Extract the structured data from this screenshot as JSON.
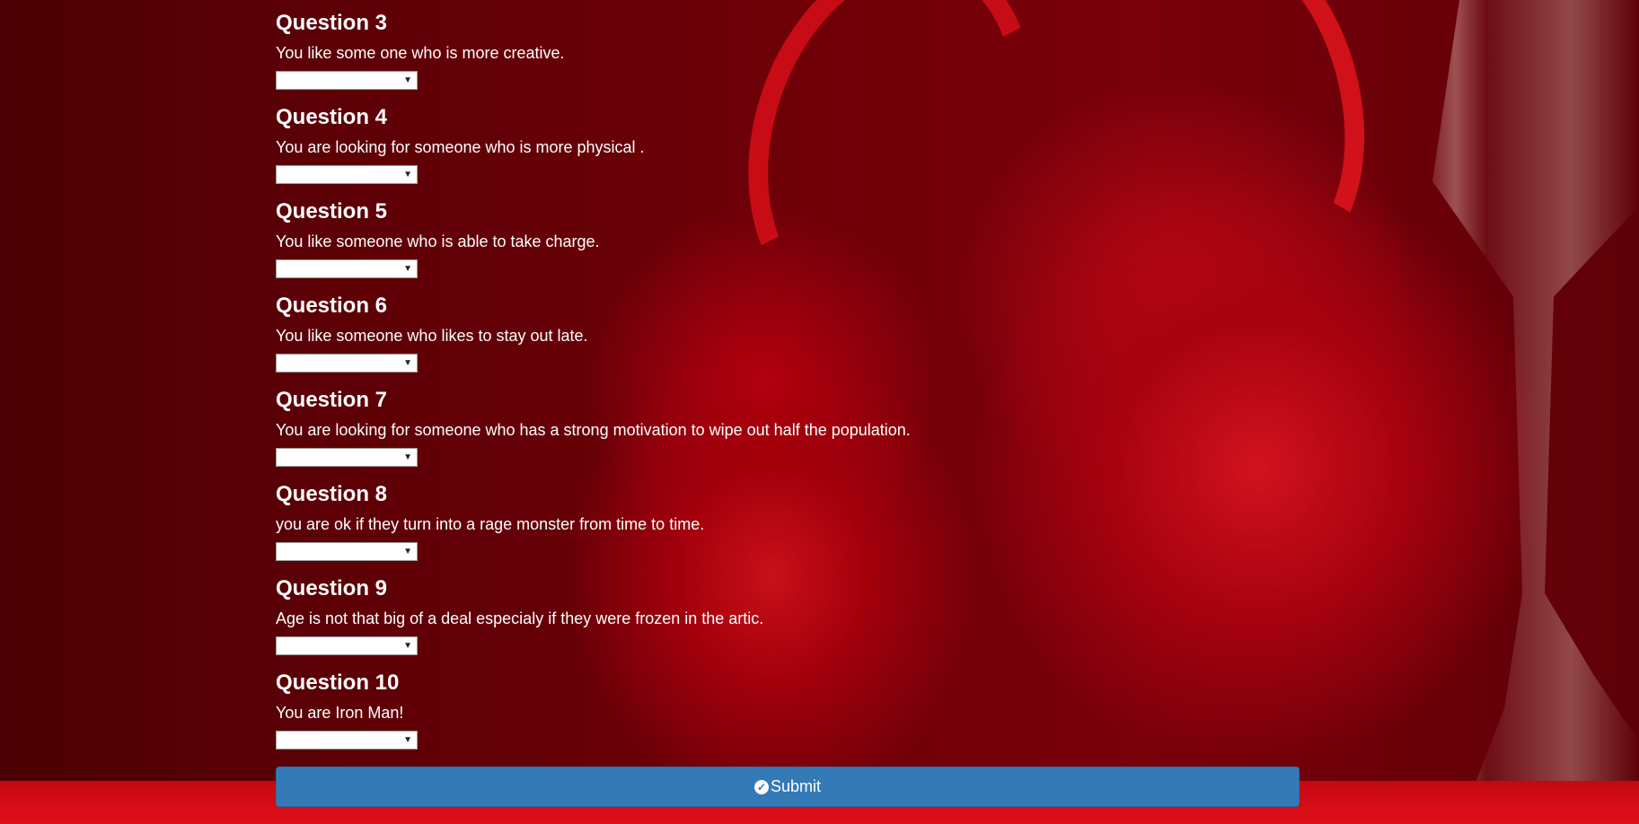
{
  "questions": [
    {
      "title": "Question 3",
      "text": "You like some one who is more creative.",
      "selected": ""
    },
    {
      "title": "Question 4",
      "text": "You are looking for someone who is more physical .",
      "selected": ""
    },
    {
      "title": "Question 5",
      "text": "You like someone who is able to take charge.",
      "selected": ""
    },
    {
      "title": "Question 6",
      "text": "You like someone who likes to stay out late.",
      "selected": ""
    },
    {
      "title": "Question 7",
      "text": "You are looking for someone who has a strong motivation to wipe out half the population.",
      "selected": ""
    },
    {
      "title": "Question 8",
      "text": "you are ok if they turn into a rage monster from time to time.",
      "selected": ""
    },
    {
      "title": "Question 9",
      "text": "Age is not that big of a deal especialy if they were frozen in the artic.",
      "selected": ""
    },
    {
      "title": "Question 10",
      "text": "You are Iron Man!",
      "selected": ""
    }
  ],
  "select": {
    "caret_icon": "triangle-down-icon"
  },
  "submit": {
    "label": "Submit",
    "icon": "check-circle-icon"
  },
  "colors": {
    "button_bg": "#337ab7",
    "text": "#ffffff",
    "background": "#6d0008"
  }
}
